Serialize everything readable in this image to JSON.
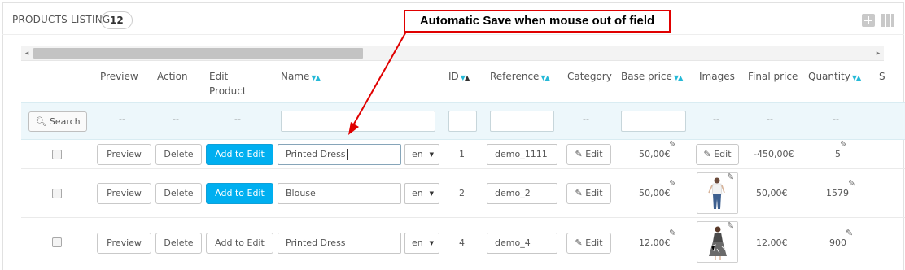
{
  "panel": {
    "title": "PRODUCTS LISTING",
    "count": "12"
  },
  "header_icons": [
    "add-new-icon",
    "columns-icon"
  ],
  "callout": {
    "text": "Automatic Save when mouse out of field",
    "color": "#e00000"
  },
  "columns": {
    "preview": "Preview",
    "action": "Action",
    "edit_product": "Edit Product",
    "name": "Name",
    "id": "ID",
    "reference": "Reference",
    "category": "Category",
    "base_price": "Base price",
    "images": "Images",
    "final_price": "Final price",
    "quantity": "Quantity",
    "cut_off": "S"
  },
  "filters": {
    "search_label": "Search",
    "dash": "--"
  },
  "colors": {
    "accent": "#00aff0",
    "filter_bg": "#edf7fb",
    "sort_arrow": "#25b9d7"
  },
  "rows": [
    {
      "preview_label": "Preview",
      "delete_label": "Delete",
      "add_to_edit_label": "Add to Edit",
      "add_to_edit_active": true,
      "name": "Printed Dress",
      "lang": "en",
      "id": "1",
      "reference": "demo_1111",
      "category_edit_label": "Edit",
      "base_price": "50,00€",
      "image_edit_label": "Edit",
      "final_price": "-450,00€",
      "quantity": "5"
    },
    {
      "preview_label": "Preview",
      "delete_label": "Delete",
      "add_to_edit_label": "Add to Edit",
      "add_to_edit_active": true,
      "name": "Blouse",
      "lang": "en",
      "id": "2",
      "reference": "demo_2",
      "category_edit_label": "Edit",
      "base_price": "50,00€",
      "final_price": "50,00€",
      "quantity": "1579"
    },
    {
      "preview_label": "Preview",
      "delete_label": "Delete",
      "add_to_edit_label": "Add to Edit",
      "add_to_edit_active": false,
      "name": "Printed Dress",
      "lang": "en",
      "id": "4",
      "reference": "demo_4",
      "category_edit_label": "Edit",
      "base_price": "12,00€",
      "final_price": "12,00€",
      "quantity": "900"
    }
  ]
}
